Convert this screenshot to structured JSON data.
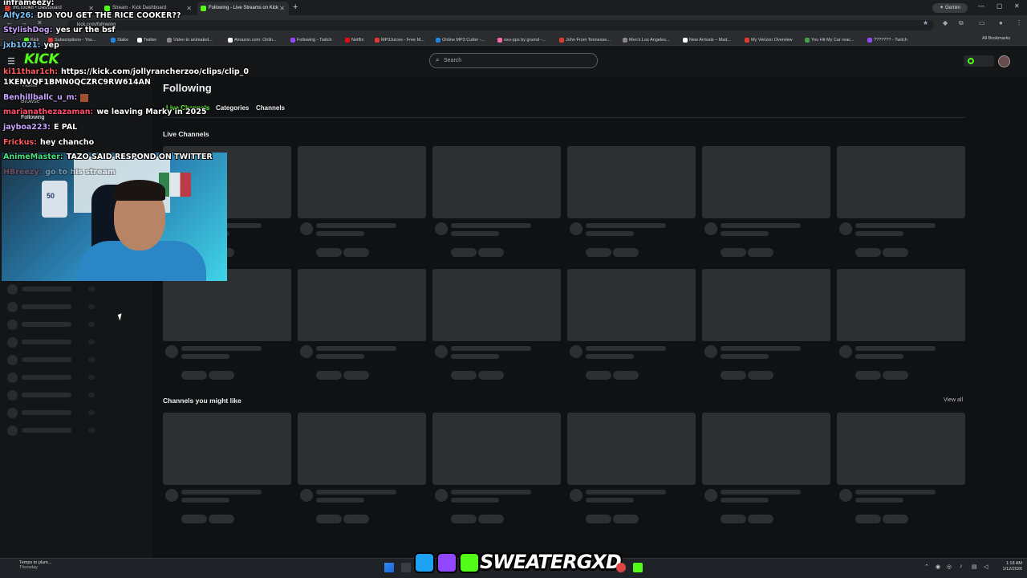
{
  "browser": {
    "tabs": [
      {
        "label": "IRLToolkit • Dashboard",
        "active": false,
        "color": "#c0392b"
      },
      {
        "label": "Stream - Kick Dashboard",
        "active": false,
        "color": "#53fc18"
      },
      {
        "label": "Following - Live Streams on Kick",
        "active": true,
        "color": "#53fc18"
      }
    ],
    "gemini_label": "Gemini",
    "url": "kick.com/following",
    "bookmarks": [
      {
        "label": "Kick",
        "color": "#53fc18"
      },
      {
        "label": "Subscriptions - You...",
        "color": "#e53935"
      },
      {
        "label": "Stake",
        "color": "#1e88e5"
      },
      {
        "label": "Twitter",
        "color": "#ffffff"
      },
      {
        "label": "Video to animated...",
        "color": "#888888"
      },
      {
        "label": "Amazon.com: Onlin...",
        "color": "#ffffff"
      },
      {
        "label": "Following - Twitch",
        "color": "#9146ff"
      },
      {
        "label": "Netflix",
        "color": "#e50914"
      },
      {
        "label": "MP3Juices - Free M...",
        "color": "#e53935"
      },
      {
        "label": "Online MP3 Cutter -...",
        "color": "#1e88e5"
      },
      {
        "label": "osu-pps by grumd -...",
        "color": "#ff66aa"
      },
      {
        "label": "John From Tennesse...",
        "color": "#e53935"
      },
      {
        "label": "Men's Los Angeles...",
        "color": "#888888"
      },
      {
        "label": "New Arrivals – Mad...",
        "color": "#ffffff"
      },
      {
        "label": "My Verizon Overview",
        "color": "#e53935"
      },
      {
        "label": "You Hit My Car reac...",
        "color": "#43a047"
      },
      {
        "label": "??????? - Twitch",
        "color": "#9146ff"
      }
    ],
    "all_bookmarks": "All Bookmarks"
  },
  "kick": {
    "logo": "KICK",
    "search_placeholder": "Search",
    "sidebar_nav": [
      "Home",
      "Browse",
      "Following"
    ],
    "page_title": "Following",
    "subtabs": [
      "Live Channels",
      "Categories",
      "Channels"
    ],
    "live_section": "Live Channels",
    "suggest_section": "Channels you might like",
    "view_all": "View all"
  },
  "overlay": {
    "jersey_number": "50",
    "chat": [
      {
        "user": "inframeezy:",
        "msg": "",
        "color": "#ffffff"
      },
      {
        "user": "Alfy26:",
        "msg": "DID YOU GET THE RICE COOKER??",
        "color": "#7ec8ff"
      },
      {
        "user": "StylishDog:",
        "msg": "yes ur the bsf",
        "color": "#c9a3ff"
      },
      {
        "user": "jxb1021:",
        "msg": "yep",
        "color": "#7ec8ff"
      },
      {
        "user": "ki11thar1ch:",
        "msg": "https://kick.com/jollyrancherzoo/clips/clip_0",
        "color": "#ff5c5c"
      },
      {
        "user": "",
        "msg": "1KENVQF1BMN0QCZRC9RW614AN",
        "color": "#ffffff"
      },
      {
        "user": "Benhillballc_u_m:",
        "msg": "",
        "color": "#c9a3ff"
      },
      {
        "user": "marianathezazaman:",
        "msg": "we leaving Marky in 2025",
        "color": "#ff4d6d"
      },
      {
        "user": "jayboa223:",
        "msg": "E PAL",
        "color": "#c9a3ff"
      },
      {
        "user": "Frickus:",
        "msg": "hey chancho",
        "color": "#ff5c5c"
      },
      {
        "user": "AnimeMaster:",
        "msg": "TAZO SAID RESPOND ON TWITTER",
        "color": "#4ade80"
      },
      {
        "user": "HBreezy:",
        "msg": "go to his stream",
        "color": "#ff5c5c"
      }
    ],
    "brand": "SWEATERGXD"
  },
  "taskbar": {
    "weather_line1": "Temps to plum...",
    "weather_line2": "Thursday",
    "time": "1:18 AM",
    "date": "1/12/2026"
  }
}
